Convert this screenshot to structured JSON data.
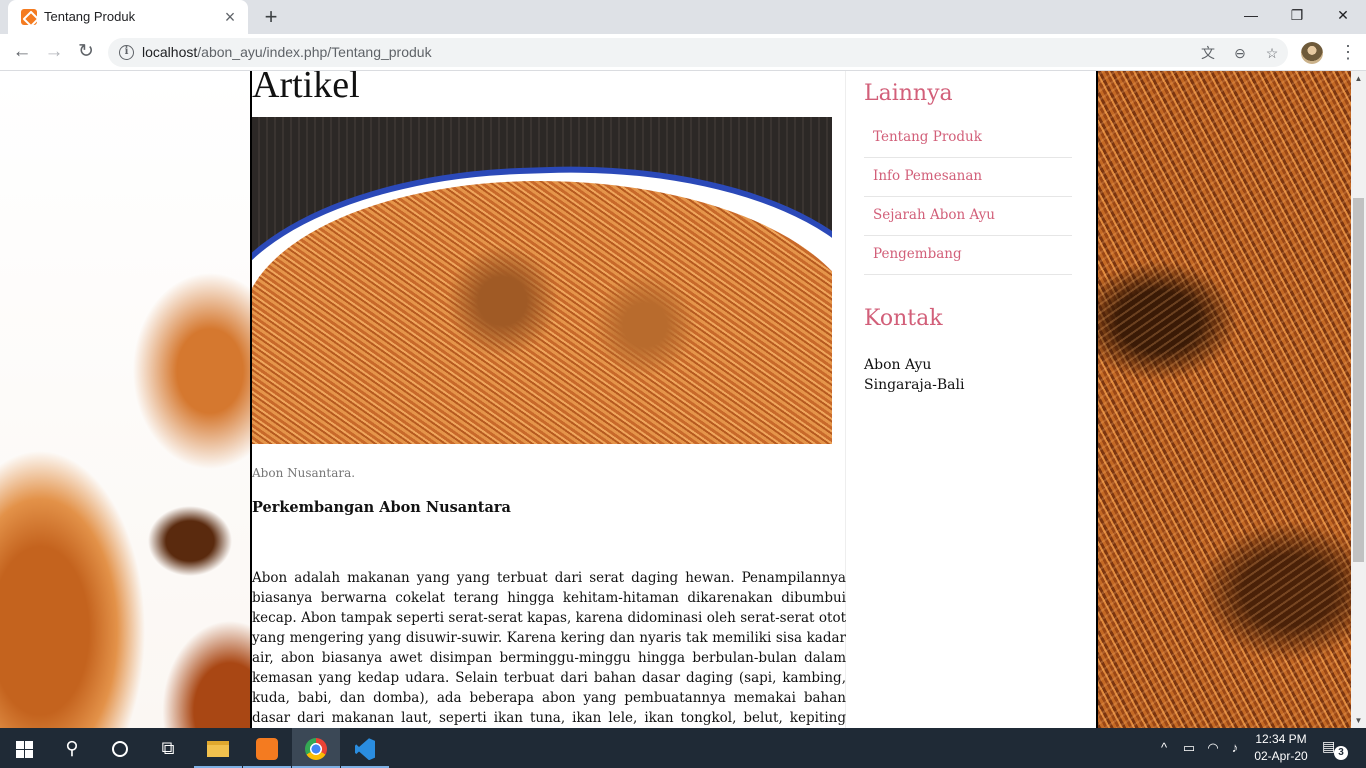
{
  "browser": {
    "tab_title": "Tentang Produk",
    "tab_close": "×",
    "new_tab": "+",
    "url_host": "localhost",
    "url_path": "/abon_ayu/index.php/Tentang_produk",
    "icons": [
      "back-icon",
      "forward-icon",
      "reload-icon",
      "info-icon",
      "translate-icon",
      "zoom-icon",
      "star-icon",
      "profile-avatar",
      "menu-icon"
    ]
  },
  "window_controls": {
    "minimize": "—",
    "restore": "❐",
    "close": "✕"
  },
  "page": {
    "title": "Artikel",
    "image_caption": "Abon Nusantara.",
    "section_title": "Perkembangan Abon Nusantara",
    "article_text": "Abon adalah makanan yang yang terbuat dari serat daging hewan. Penampilannya biasanya berwarna cokelat terang hingga kehitam-hitaman dikarenakan dibumbui kecap. Abon tampak seperti serat-serat kapas, karena didominasi oleh serat-serat otot yang mengering yang disuwir-suwir. Karena kering dan nyaris tak memiliki sisa kadar air, abon biasanya awet disimpan berminggu-minggu hingga berbulan-bulan dalam kemasan yang kedap udara. Selain terbuat dari bahan dasar daging (sapi, kambing, kuda, babi, dan domba), ada beberapa abon yang pembuatannya memakai bahan dasar dari makanan laut, seperti ikan tuna, ikan lele, ikan tongkol, belut, kepiting rajungan dan udang. Abon biasanya dimakan"
  },
  "sidebar": {
    "menu_heading": "Lainnya",
    "menu_items": [
      {
        "label": "Tentang Produk"
      },
      {
        "label": "Info Pemesanan"
      },
      {
        "label": "Sejarah Abon Ayu"
      },
      {
        "label": "Pengembang"
      }
    ],
    "contact_heading": "Kontak",
    "contact_name": "Abon Ayu",
    "contact_city": "Singaraja-Bali"
  },
  "taskbar": {
    "clock_time": "12:34 PM",
    "clock_date": "02-Apr-20",
    "notification_count": "3",
    "apps": [
      "start",
      "search",
      "cortana",
      "task-view",
      "file-explorer",
      "xampp",
      "chrome",
      "vscode"
    ]
  },
  "colors": {
    "accent_pink": "#d25f79",
    "taskbar_bg": "#1f2a36",
    "tab_strip_bg": "#dee1e6"
  }
}
